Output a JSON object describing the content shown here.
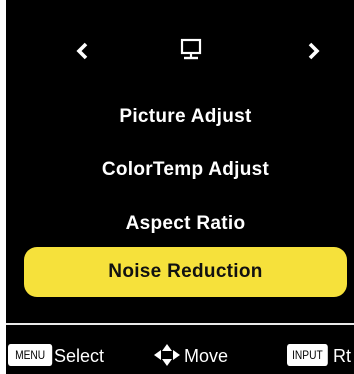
{
  "nav": {
    "left_icon": "chevron-left-icon",
    "center_icon": "monitor-icon",
    "right_icon": "chevron-right-icon"
  },
  "menu": {
    "items": [
      {
        "label": "Picture Adjust"
      },
      {
        "label": "ColorTemp Adjust"
      },
      {
        "label": "Aspect Ratio"
      },
      {
        "label": "Noise Reduction",
        "selected": true
      }
    ]
  },
  "hints": {
    "menu_key": "MENU",
    "select_label": "Select",
    "move_icon": "directional-pad-icon",
    "move_label": "Move",
    "input_key": "INPUT",
    "rt_label": "Rt"
  },
  "colors": {
    "background": "#000000",
    "highlight": "#f6e13b",
    "text": "#ffffff",
    "selected_text": "#111111"
  }
}
